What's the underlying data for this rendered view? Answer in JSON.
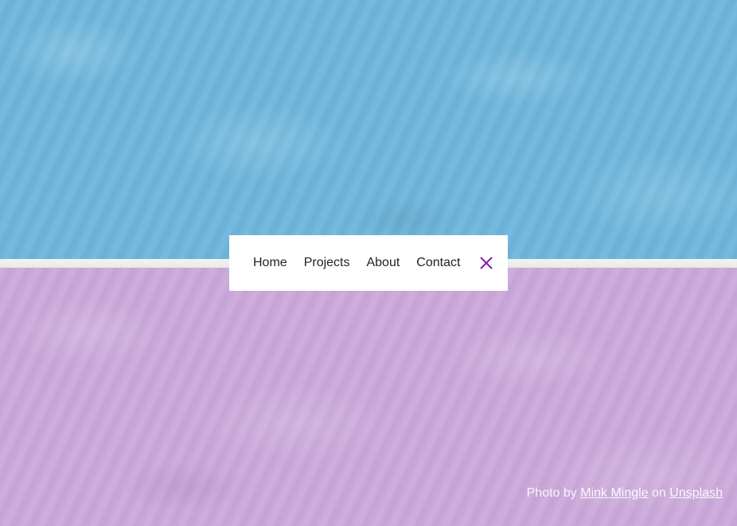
{
  "nav": {
    "links": [
      "Home",
      "Projects",
      "About",
      "Contact"
    ],
    "close_icon": "close-icon",
    "accent_color": "#8a1fb0"
  },
  "credit": {
    "prefix": "Photo by",
    "author": "Mink Mingle",
    "middle": "on",
    "source": "Unsplash"
  },
  "colors": {
    "top_water": "#6eb6dc",
    "bottom_water": "#cba8da",
    "divider": "#efeeea",
    "nav_background": "#ffffff"
  }
}
